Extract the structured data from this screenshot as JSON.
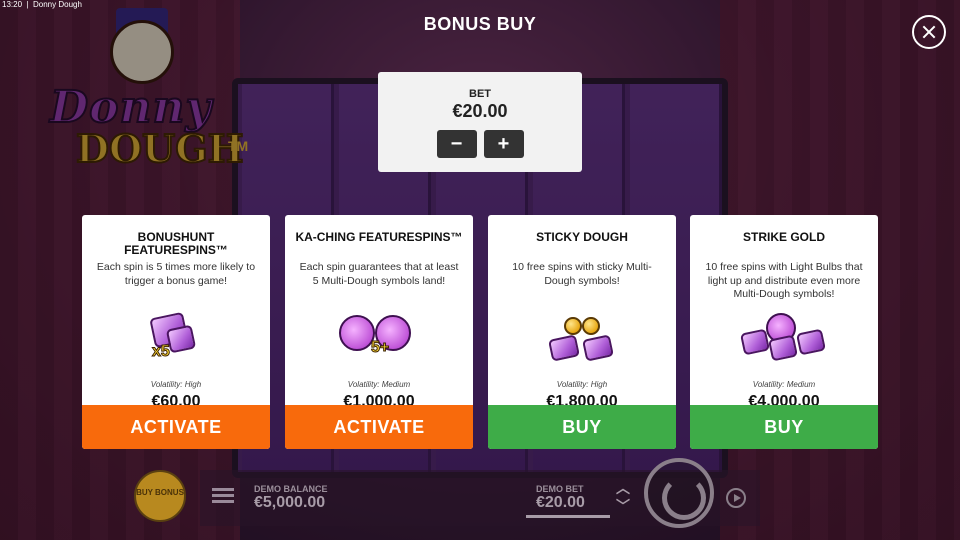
{
  "statusbar": {
    "time": "13:20",
    "app_name": "Donny Dough"
  },
  "logo": {
    "line1": "Donny",
    "line2": "DOUGH",
    "tm": "TM"
  },
  "modal": {
    "title": "BONUS BUY",
    "bet": {
      "label": "BET",
      "value": "€20.00",
      "minus": "−",
      "plus": "+"
    },
    "cards": [
      {
        "title": "BONUSHUNT FEATURESPINS™",
        "description": "Each spin is 5 times more likely to trigger a bonus game!",
        "art_badge": "x5",
        "volatility": "Volatility: High",
        "price": "€60.00",
        "button": "ACTIVATE",
        "button_color": "#f86a0c"
      },
      {
        "title": "KA-CHING FEATURESPINS™",
        "description": "Each spin guarantees that at least 5 Multi-Dough symbols land!",
        "art_badge": "5+",
        "volatility": "Volatility: Medium",
        "price": "€1,000.00",
        "button": "ACTIVATE",
        "button_color": "#f86a0c"
      },
      {
        "title": "STICKY DOUGH",
        "description": "10 free spins with sticky Multi-Dough symbols!",
        "volatility": "Volatility: High",
        "price": "€1,800.00",
        "button": "BUY",
        "button_color": "#3eac48"
      },
      {
        "title": "STRIKE GOLD",
        "description": "10 free spins with Light Bulbs that light up and distribute even more Multi-Dough symbols!",
        "volatility": "Volatility: Medium",
        "price": "€4,000.00",
        "button": "BUY",
        "button_color": "#3eac48"
      }
    ]
  },
  "bottom_bar": {
    "buy_bonus": "BUY BONUS",
    "demo_balance_label": "DEMO BALANCE",
    "demo_balance_value": "€5,000.00",
    "demo_bet_label": "DEMO BET",
    "demo_bet_value": "€20.00"
  }
}
